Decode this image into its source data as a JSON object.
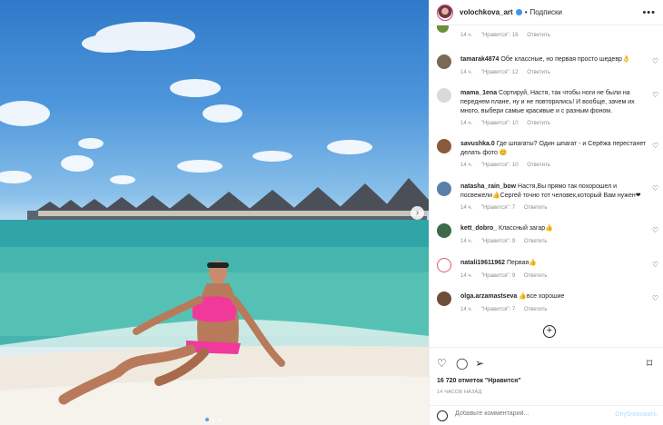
{
  "header": {
    "username": "volochkova_art",
    "separator": "•",
    "follow_label": "Подписки",
    "more_label": "•••"
  },
  "comments": [
    {
      "user": "",
      "text": "",
      "time": "14 ч.",
      "likes": "\"Нравится\": 16",
      "reply": "Ответить",
      "avatar_color": "#6b8e3a"
    },
    {
      "user": "tamarak4874",
      "text": "Обе классные, но первая просто шедевр👌",
      "time": "14 ч.",
      "likes": "\"Нравится\": 12",
      "reply": "Ответить",
      "avatar_color": "#7a6a55"
    },
    {
      "user": "mama_1ena",
      "text": "Сортируй, Настя, так чтобы ноги не были на переднем плане, ну и не повторялись! И вообще, зачем их много, выбери самые красивые и с разным фоном.",
      "time": "14 ч.",
      "likes": "\"Нравится\": 10",
      "reply": "Ответить",
      "avatar_color": "#d9d9d9"
    },
    {
      "user": "savushka.0",
      "text": "Где шпагаты? Один шпагат - и Серёжа перестанет делать фото 😊",
      "time": "14 ч.",
      "likes": "\"Нравится\": 10",
      "reply": "Ответить",
      "avatar_color": "#8a5a3c"
    },
    {
      "user": "natasha_rain_bow",
      "text": "Настя,Вы прямо так похорошел и посвежели👍Сергей точно тот человек,который Вам нужен❤",
      "time": "14 ч.",
      "likes": "\"Нравится\": 7",
      "reply": "Ответить",
      "avatar_color": "#5a7fa8"
    },
    {
      "user": "kett_dobro_",
      "text": "Классный загар👍",
      "time": "14 ч.",
      "likes": "\"Нравится\": 9",
      "reply": "Ответить",
      "avatar_color": "#3d6b4a"
    },
    {
      "user": "natali19611962",
      "text": "Первая👍",
      "time": "14 ч.",
      "likes": "\"Нравится\": 9",
      "reply": "Ответить",
      "avatar_color": "#e05a6a"
    },
    {
      "user": "olga.arzamastseva",
      "text": "👍все хорошие",
      "time": "14 ч.",
      "likes": "\"Нравится\": 7",
      "reply": "Ответить",
      "avatar_color": "#6e4e3a"
    }
  ],
  "actions": {
    "likes_text": "16 720 отметок \"Нравится\"",
    "posted_ago": "14 ЧАСОВ НАЗАД",
    "comment_placeholder": "Добавьте комментарий...",
    "publish_label": "Опубликовать"
  },
  "icons": {
    "like": "heart-icon",
    "comment": "comment-icon",
    "share": "share-icon",
    "save": "bookmark-icon",
    "emoji": "emoji-icon",
    "next": "chevron-right-icon",
    "load_more": "plus-circle-icon"
  }
}
